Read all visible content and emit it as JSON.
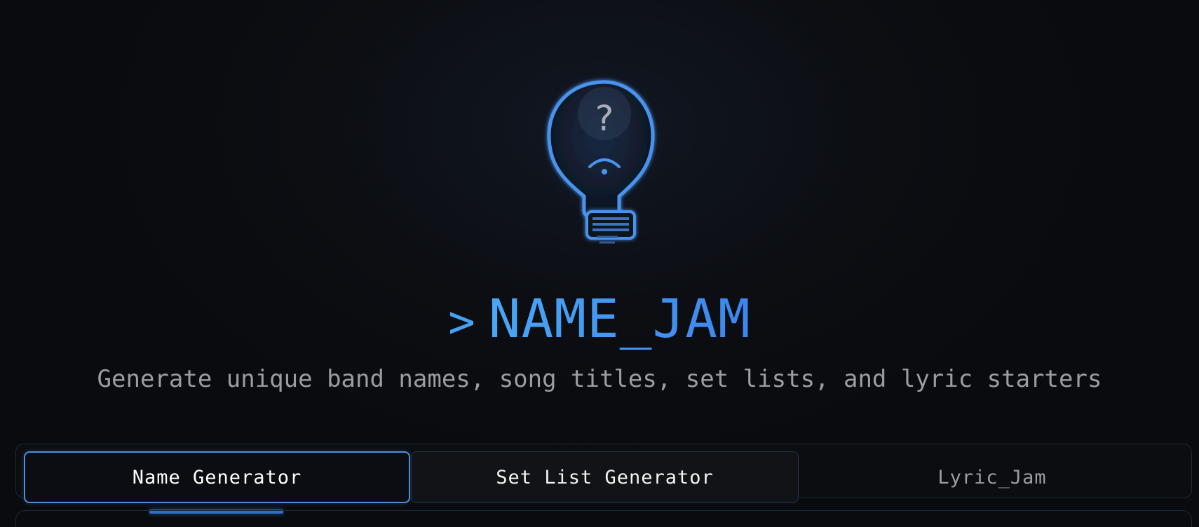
{
  "header": {
    "logo_icon": "lightbulb-question-icon",
    "logo_glyph": "?",
    "prompt_symbol": ">",
    "app_name": "NAME_JAM",
    "subtitle": "Generate unique band names, song titles, set lists, and lyric starters"
  },
  "tabs": [
    {
      "label": "Name Generator",
      "active": true
    },
    {
      "label": "Set List Generator",
      "active": false
    },
    {
      "label": "Lyric_Jam",
      "active": false
    }
  ],
  "colors": {
    "accent": "#3e8ef0",
    "background": "#0a0b0e",
    "muted_text": "#9a9da3",
    "active_tab_border": "#4a8fe0"
  }
}
